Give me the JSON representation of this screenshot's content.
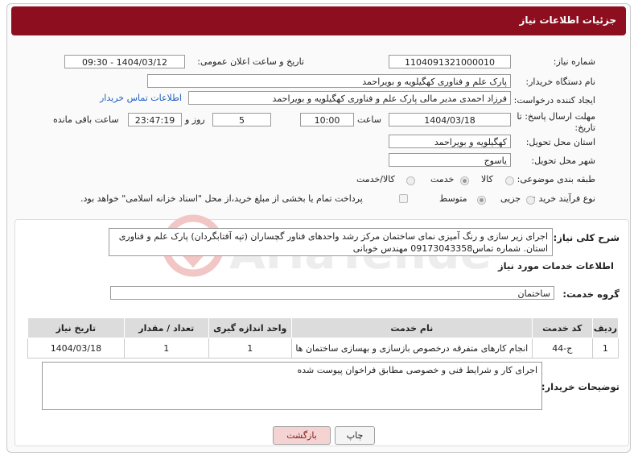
{
  "header": {
    "title": "جزئیات اطلاعات نیاز"
  },
  "fields": {
    "need_number_label": "شماره نیاز:",
    "need_number": "1104091321000010",
    "announce_label": "تاریخ و ساعت اعلان عمومی:",
    "announce_value": "1404/03/12 - 09:30",
    "buyer_org_label": "نام دستگاه خریدار:",
    "buyer_org": "پارک علم و فناوری کهگیلویه و بویراحمد",
    "creator_label": "ایجاد کننده درخواست:",
    "creator": "فرزاد احمدی مدیر مالی پارک علم و فناوری کهگیلویه و بویراحمد",
    "contact_link": "اطلاعات تماس خریدار",
    "deadline_label": "مهلت ارسال پاسخ: تا تاریخ:",
    "deadline_date": "1404/03/18",
    "hour_label": "ساعت",
    "deadline_hour": "10:00",
    "days": "5",
    "days_label": "روز و",
    "remaining_time": "23:47:19",
    "remaining_label": "ساعت باقی مانده",
    "province_label": "استان محل تحویل:",
    "province": "کهگیلویه و بویراحمد",
    "city_label": "شهر محل تحویل:",
    "city": "یاسوج",
    "category_label": "طبقه بندی موضوعی:",
    "category_options": [
      "کالا",
      "خدمت",
      "کالا/خدمت"
    ],
    "category_selected": "خدمت",
    "process_label": "نوع فرآیند خرید :",
    "process_options": [
      "جزیی",
      "متوسط"
    ],
    "process_selected": "متوسط",
    "payment_note": "پرداخت تمام یا بخشی از مبلغ خرید،از محل \"اسناد خزانه اسلامی\" خواهد بود."
  },
  "description": {
    "label": "شرح کلی نیاز:",
    "text": "اجرای زیر سازی و رنگ آمیزی نمای ساختمان مرکز رشد واحدهای فناور گچساران (تپه آفتابگردان) پارک علم و فناوری استان. شماره تماس09173043358 مهندس خوبانی"
  },
  "services": {
    "title": "اطلاعات خدمات مورد نیاز",
    "group_label": "گروه خدمت:",
    "group_value": "ساختمان",
    "columns": [
      "ردیف",
      "کد خدمت",
      "نام خدمت",
      "واحد اندازه گیری",
      "تعداد / مقدار",
      "تاریخ نیاز"
    ],
    "rows": [
      [
        "1",
        "ج-44",
        "انجام کارهای متفرقه درخصوص بازسازی و بهسازی ساختمان ها",
        "1",
        "1",
        "1404/03/18"
      ]
    ]
  },
  "buyer_notes": {
    "label": "توضیحات خریدار:",
    "text": "اجرای کار و شرایط فنی و خصوصی مطابق فراخوان پیوست شده"
  },
  "buttons": {
    "print": "چاپ",
    "back": "بازگشت"
  },
  "colors": {
    "header_bg": "#8d0e1e",
    "link": "#1f5fbf",
    "back_btn_bg": "#f6d3d3"
  }
}
